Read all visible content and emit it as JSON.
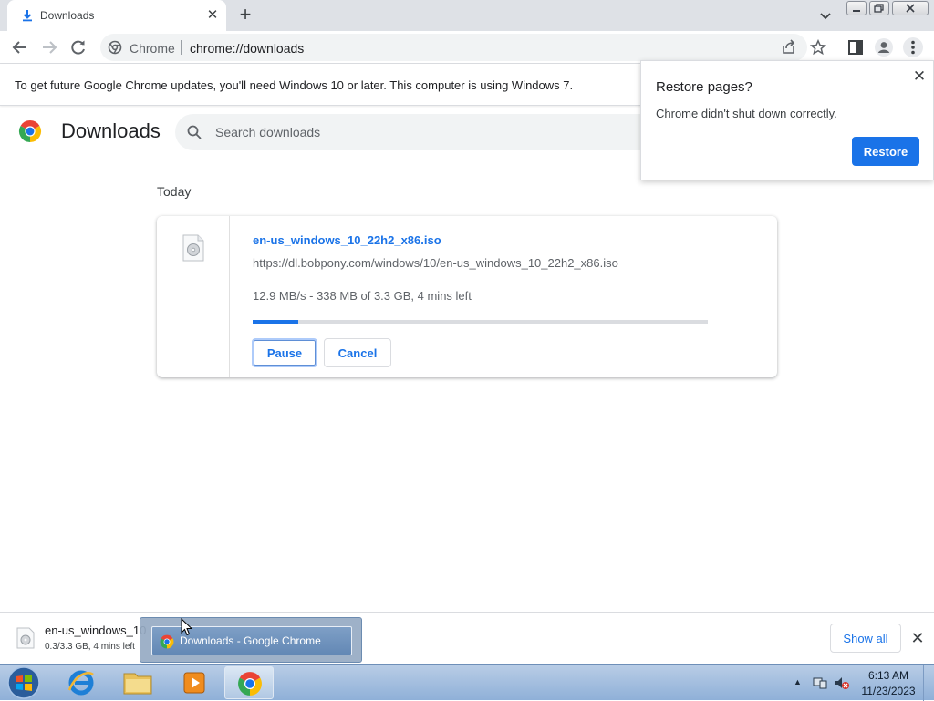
{
  "tab": {
    "title": "Downloads",
    "close": "✕",
    "new_tab": "+"
  },
  "toolbar": {
    "site_chip": "Chrome",
    "url": "chrome://downloads"
  },
  "infobar": {
    "text": "To get future Google Chrome updates, you'll need Windows 10 or later. This computer is using Windows 7."
  },
  "downloads": {
    "title": "Downloads",
    "search_placeholder": "Search downloads",
    "section": "Today",
    "item": {
      "filename": "en-us_windows_10_22h2_x86.iso",
      "url": "https://dl.bobpony.com/windows/10/en-us_windows_10_22h2_x86.iso",
      "status": "12.9 MB/s - 338 MB of 3.3 GB, 4 mins left",
      "progress_fraction": 0.1,
      "pause_label": "Pause",
      "cancel_label": "Cancel"
    }
  },
  "restore": {
    "title": "Restore pages?",
    "message": "Chrome didn't shut down correctly.",
    "button": "Restore",
    "close": "✕"
  },
  "shelf": {
    "filename": "en-us_windows_10",
    "status": "0.3/3.3 GB, 4 mins left",
    "show_all": "Show all",
    "close": "✕"
  },
  "taskbar": {
    "preview_title": "Downloads - Google Chrome",
    "time": "6:13 AM",
    "date": "11/23/2023",
    "tray_arrow": "▲"
  },
  "colors": {
    "accent": "#1a73e8",
    "tabstrip": "#dee1e6",
    "omnibox": "#f1f3f4"
  },
  "icons": [
    "download-icon",
    "back-icon",
    "forward-icon",
    "reload-icon",
    "share-icon",
    "star-icon",
    "side-panel-icon",
    "profile-icon",
    "menu-icon",
    "chrome-logo-icon",
    "search-icon",
    "file-disc-icon",
    "windows-start-icon",
    "internet-explorer-icon",
    "folder-icon",
    "media-player-icon",
    "chrome-icon",
    "network-icon",
    "volume-muted-icon"
  ]
}
